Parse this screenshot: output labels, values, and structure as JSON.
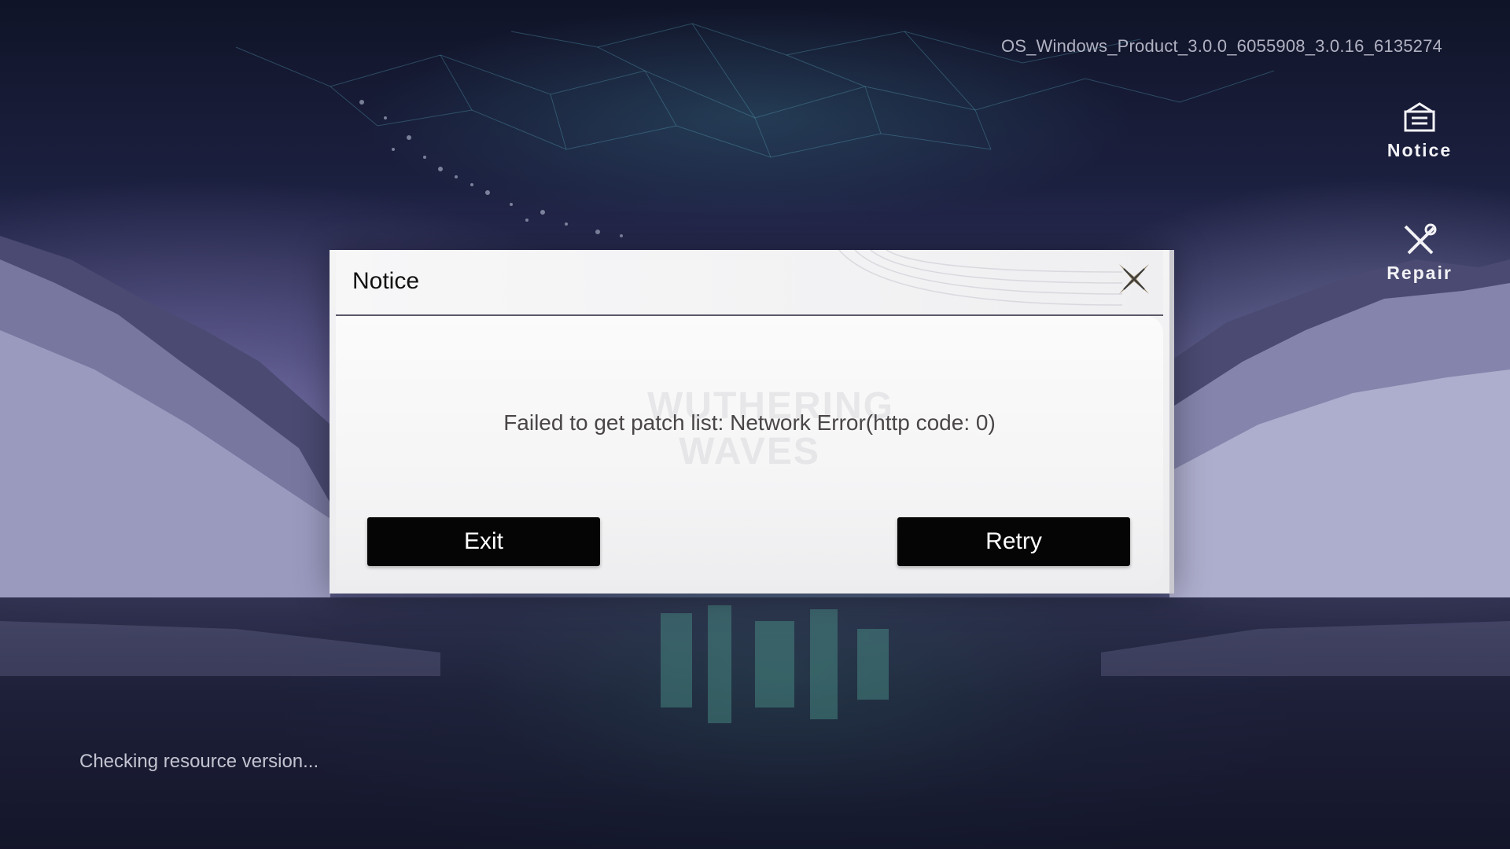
{
  "app": {
    "build_version": "OS_Windows_Product_3.0.0_6055908_3.0.16_6135274",
    "status_text": "Checking resource version..."
  },
  "side_menu": {
    "notice_label": "Notice",
    "notice_icon": "notice-box-icon",
    "repair_label": "Repair",
    "repair_icon": "wrench-screwdriver-icon"
  },
  "dialog": {
    "title": "Notice",
    "close_icon": "close-x-icon",
    "message": "Failed to get patch list: Network Error(http code: 0)",
    "exit_label": "Exit",
    "retry_label": "Retry",
    "watermark_lines": [
      "WUTHERING",
      "WAVES"
    ]
  },
  "colors": {
    "dialog_bg": "#f4f4f5",
    "button_bg": "#050505",
    "button_text": "#ffffff",
    "message_text": "#4a4648",
    "close_icon_color": "#8a7a5a"
  }
}
